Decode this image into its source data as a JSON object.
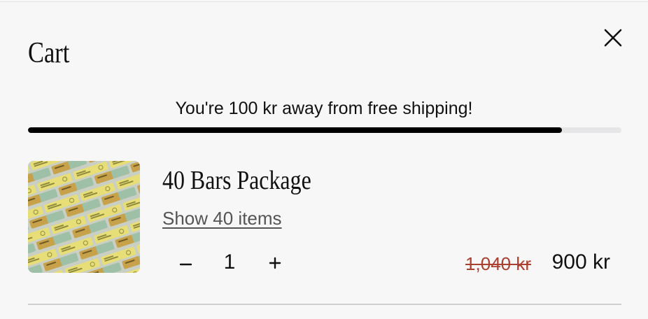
{
  "cart": {
    "title": "Cart",
    "close_icon": "close-icon"
  },
  "shipping": {
    "message": "You're 100 kr away from free shipping!",
    "progress_fraction": 0.9
  },
  "item": {
    "image_alt": "40 Bars Package product image",
    "title": "40 Bars Package",
    "show_items_label": "Show 40 items",
    "quantity": "1",
    "minus_icon": "minus-icon",
    "plus_icon": "plus-icon",
    "original_price": "1,040 kr",
    "price": "900 kr"
  },
  "colors": {
    "background": "#f7f7f7",
    "progress_fill": "#000000",
    "progress_track": "#e6e6e8",
    "strikethrough_price": "#a8412f"
  }
}
